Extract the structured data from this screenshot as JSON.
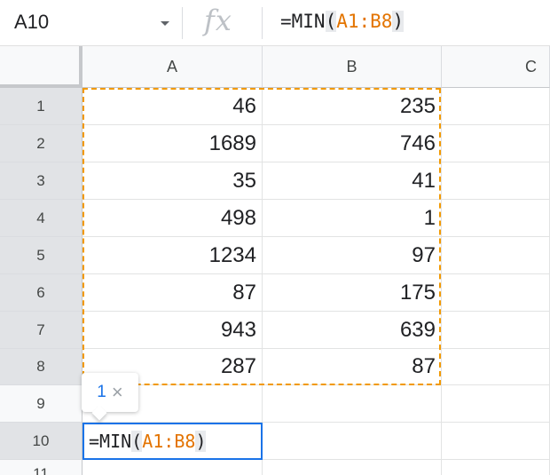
{
  "formula_bar": {
    "name_box": "A10",
    "fx_icon": "fx",
    "formula": {
      "prefix": "=MIN",
      "open_paren": "(",
      "range_ref": "A1:B8",
      "close_paren": ")"
    }
  },
  "columns": [
    "A",
    "B",
    "C"
  ],
  "rows": [
    "1",
    "2",
    "3",
    "4",
    "5",
    "6",
    "7",
    "8",
    "9",
    "10",
    "11"
  ],
  "cells": {
    "A": [
      "46",
      "1689",
      "35",
      "498",
      "1234",
      "87",
      "943",
      "287"
    ],
    "B": [
      "235",
      "746",
      "41",
      "1",
      "97",
      "175",
      "639",
      "87"
    ]
  },
  "active_cell": {
    "prefix": "=MIN",
    "open_paren": "(",
    "range_ref": "A1:B8",
    "close_paren": ")"
  },
  "hint_chip": {
    "count": "1",
    "close_icon": "close-icon",
    "close": "×"
  },
  "colors": {
    "range_outline": "#f29900",
    "range_ref_text": "#e37400",
    "active_border": "#1a73e8"
  }
}
